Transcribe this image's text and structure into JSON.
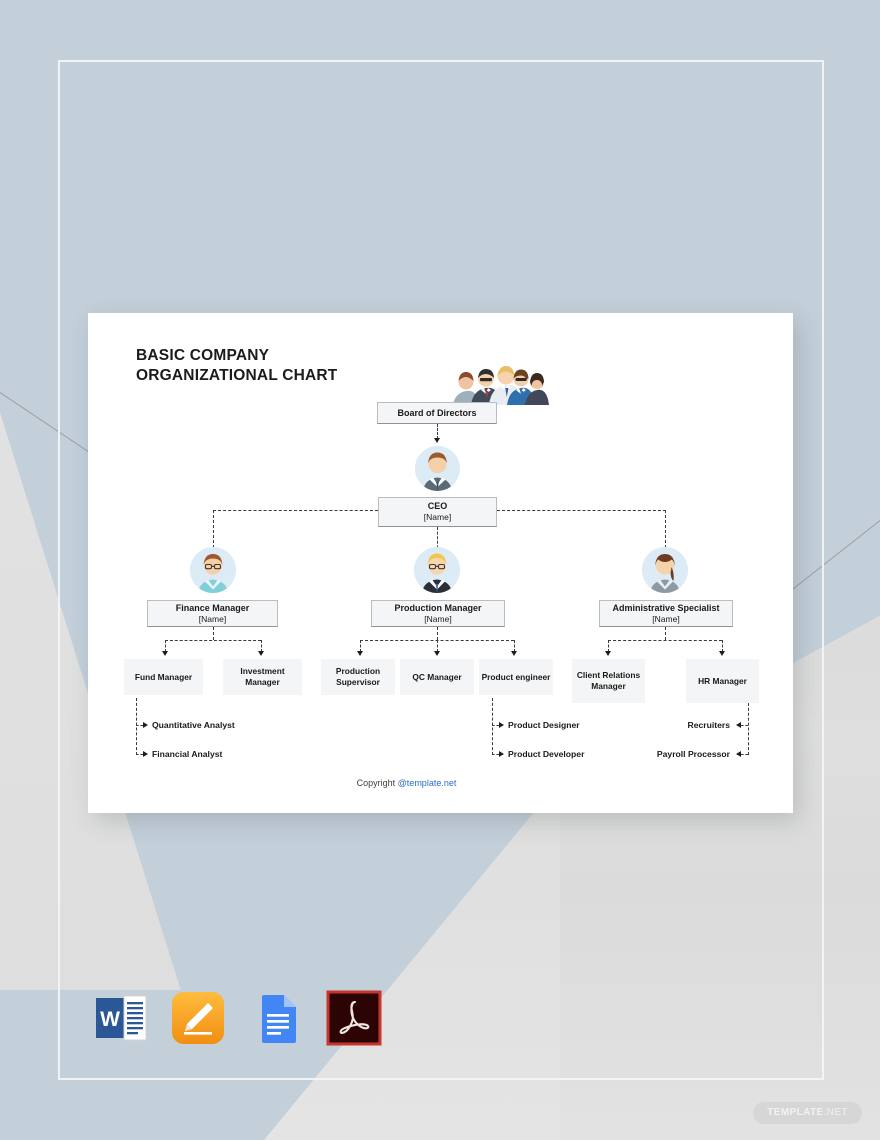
{
  "document": {
    "title": "BASIC COMPANY\nORGANIZATIONAL CHART",
    "copyright_prefix": "Copyright ",
    "copyright_link": "@template.net"
  },
  "chart_data": {
    "type": "diagram",
    "title": "BASIC COMPANY ORGANIZATIONAL CHART",
    "levels": [
      {
        "level": 0,
        "nodes": [
          {
            "label": "Board of Directors",
            "sub": "",
            "avatar": "group-of-people-icon"
          }
        ]
      },
      {
        "level": 1,
        "nodes": [
          {
            "label": "CEO",
            "sub": "[Name]",
            "avatar": "male-executive-avatar-icon"
          }
        ]
      },
      {
        "level": 2,
        "nodes": [
          {
            "label": "Finance Manager",
            "sub": "[Name]",
            "avatar": "male-glasses-avatar-icon"
          },
          {
            "label": "Production Manager",
            "sub": "[Name]",
            "avatar": "blond-male-avatar-icon"
          },
          {
            "label": "Administrative Specialist",
            "sub": "[Name]",
            "avatar": "female-avatar-icon"
          }
        ]
      },
      {
        "level": 3,
        "nodes": [
          {
            "label": "Fund Manager",
            "parent": "Finance Manager"
          },
          {
            "label": "Investment Manager",
            "parent": "Finance Manager"
          },
          {
            "label": "Production Supervisor",
            "parent": "Production Manager"
          },
          {
            "label": "QC Manager",
            "parent": "Production Manager"
          },
          {
            "label": "Product engineer",
            "parent": "Production Manager"
          },
          {
            "label": "Client Relations Manager",
            "parent": "Administrative Specialist"
          },
          {
            "label": "HR Manager",
            "parent": "Administrative Specialist"
          }
        ]
      },
      {
        "level": 4,
        "nodes": [
          {
            "label": "Quantitative Analyst",
            "parent": "Fund Manager"
          },
          {
            "label": "Financial Analyst",
            "parent": "Fund Manager"
          },
          {
            "label": "Product Designer",
            "parent": "Product engineer"
          },
          {
            "label": "Product Developer",
            "parent": "Product engineer"
          },
          {
            "label": "Recruiters",
            "parent": "HR Manager"
          },
          {
            "label": "Payroll Processor",
            "parent": "HR Manager"
          }
        ]
      }
    ],
    "colors": {
      "node_fill": "#f4f5f6",
      "node_border": "#b9bcc0",
      "connector": "#3a3a3a",
      "avatar_bg": "#dcebf5",
      "link": "#2a6fc9"
    }
  },
  "nodes": {
    "board": {
      "label": "Board of Directors"
    },
    "ceo": {
      "label": "CEO",
      "sub": "[Name]"
    },
    "finance": {
      "label": "Finance Manager",
      "sub": "[Name]"
    },
    "production": {
      "label": "Production Manager",
      "sub": "[Name]"
    },
    "admin": {
      "label": "Administrative Specialist",
      "sub": "[Name]"
    },
    "fund_manager": {
      "label": "Fund Manager"
    },
    "investment_manager": {
      "label": "Investment Manager"
    },
    "production_supervisor": {
      "label": "Production Supervisor"
    },
    "qc_manager": {
      "label": "QC Manager"
    },
    "product_engineer": {
      "label": "Product engineer"
    },
    "client_relations_manager": {
      "label": "Client Relations Manager"
    },
    "hr_manager": {
      "label": "HR Manager"
    },
    "quantitative_analyst": {
      "label": "Quantitative Analyst"
    },
    "financial_analyst": {
      "label": "Financial Analyst"
    },
    "product_designer": {
      "label": "Product Designer"
    },
    "product_developer": {
      "label": "Product Developer"
    },
    "recruiters": {
      "label": "Recruiters"
    },
    "payroll_processor": {
      "label": "Payroll Processor"
    }
  },
  "file_formats": [
    {
      "name": "microsoft-word-icon",
      "label": "W"
    },
    {
      "name": "apple-pages-icon",
      "label": ""
    },
    {
      "name": "google-docs-icon",
      "label": ""
    },
    {
      "name": "adobe-pdf-icon",
      "label": ""
    }
  ],
  "watermark": {
    "main": "TEMPLATE",
    "suffix": ".NET"
  }
}
